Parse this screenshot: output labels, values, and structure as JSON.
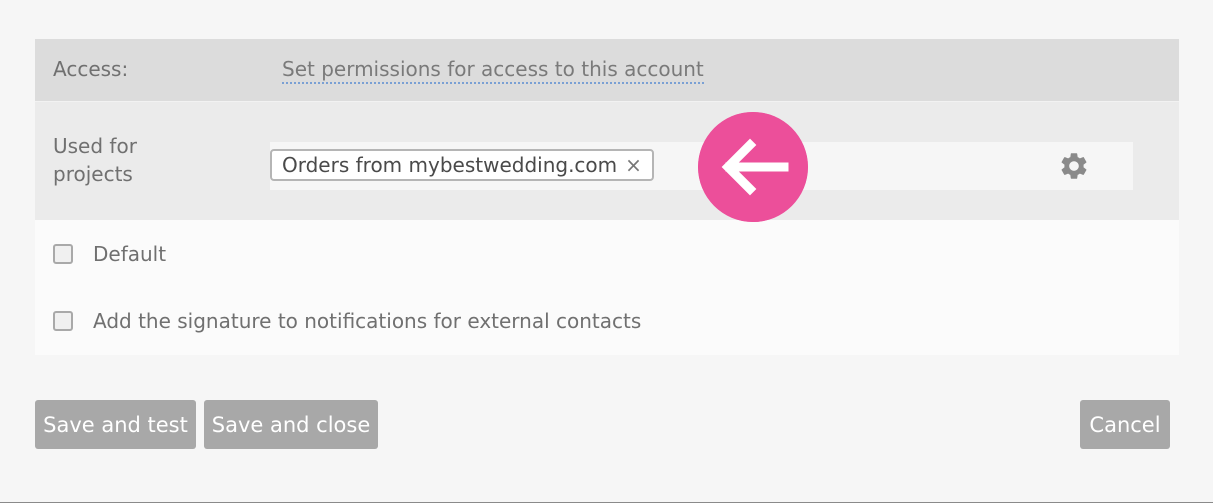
{
  "access": {
    "label": "Access:",
    "link": "Set permissions for access to this account"
  },
  "projects": {
    "label_line1": "Used for",
    "label_line2": "projects",
    "tag": "Orders from mybestwedding.com",
    "tag_remove": "×"
  },
  "options": {
    "default_label": "Default",
    "signature_label": "Add the signature to notifications for external contacts"
  },
  "buttons": {
    "save_test": "Save and test",
    "save_close": "Save and close",
    "cancel": "Cancel"
  },
  "icons": {
    "settings": "gear-icon",
    "pointer": "arrow-left-icon",
    "remove": "close-icon"
  },
  "colors": {
    "highlight": "#ec4f9a",
    "button": "#a8a8a8",
    "link_underline": "#7aa0d4"
  }
}
